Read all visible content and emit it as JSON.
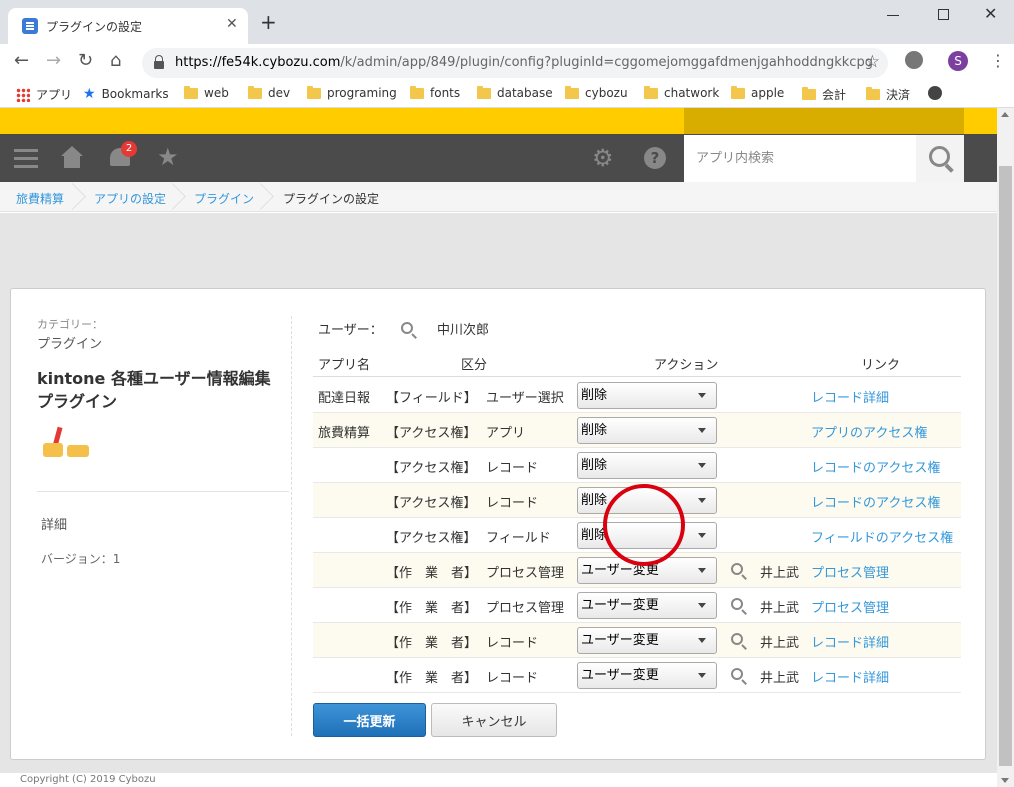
{
  "browser": {
    "tab_title": "プラグインの設定",
    "url_host": "https://fe54k.cybozu.com",
    "url_path": "/k/admin/app/849/plugin/config?pluginId=cggomejomggafdmenjgahhoddngkkcpg",
    "profile_initial": "S",
    "bookmarks": [
      "アプリ",
      "Bookmarks",
      "web",
      "dev",
      "programing",
      "fonts",
      "database",
      "cybozu",
      "chatwork",
      "apple",
      "会計",
      "決済"
    ]
  },
  "kintone": {
    "notification_count": "2",
    "search_placeholder": "アプリ内検索",
    "breadcrumbs": [
      "旅費精算",
      "アプリの設定",
      "プラグイン",
      "プラグインの設定"
    ],
    "footer": "Copyright (C) 2019 Cybozu"
  },
  "plugin": {
    "category_label": "カテゴリー：",
    "category_value": "プラグイン",
    "name": "kintone 各種ユーザー情報編集プラグイン",
    "detail_label": "詳細",
    "version": "バージョン：1"
  },
  "config": {
    "user_label": "ユーザー：",
    "user_name": "中川次郎",
    "headers": {
      "app": "アプリ名",
      "kind": "区分",
      "action": "アクション",
      "link": "リンク"
    },
    "rows": [
      {
        "app": "配達日報",
        "kind": "【フィールド】",
        "target": "ユーザー選択",
        "action": "削除",
        "user": "",
        "link": "レコード詳細"
      },
      {
        "app": "旅費精算",
        "kind": "【アクセス権】",
        "target": "アプリ",
        "action": "削除",
        "user": "",
        "link": "アプリのアクセス権"
      },
      {
        "app": "",
        "kind": "【アクセス権】",
        "target": "レコード",
        "action": "削除",
        "user": "",
        "link": "レコードのアクセス権"
      },
      {
        "app": "",
        "kind": "【アクセス権】",
        "target": "レコード",
        "action": "削除",
        "user": "",
        "link": "レコードのアクセス権"
      },
      {
        "app": "",
        "kind": "【アクセス権】",
        "target": "フィールド",
        "action": "削除",
        "user": "",
        "link": "フィールドのアクセス権"
      },
      {
        "app": "",
        "kind": "【作　業　者】",
        "target": "プロセス管理",
        "action": "ユーザー変更",
        "user": "井上武",
        "link": "プロセス管理"
      },
      {
        "app": "",
        "kind": "【作　業　者】",
        "target": "プロセス管理",
        "action": "ユーザー変更",
        "user": "井上武",
        "link": "プロセス管理"
      },
      {
        "app": "",
        "kind": "【作　業　者】",
        "target": "レコード",
        "action": "ユーザー変更",
        "user": "井上武",
        "link": "レコード詳細"
      },
      {
        "app": "",
        "kind": "【作　業　者】",
        "target": "レコード",
        "action": "ユーザー変更",
        "user": "井上武",
        "link": "レコード詳細"
      }
    ],
    "submit_label": "一括更新",
    "cancel_label": "キャンセル"
  },
  "colors": {
    "kintone_yellow": "#ffcc00",
    "nav_gray": "#4b4b4b",
    "link_blue": "#3498db",
    "annotation_red": "#d9000f"
  }
}
